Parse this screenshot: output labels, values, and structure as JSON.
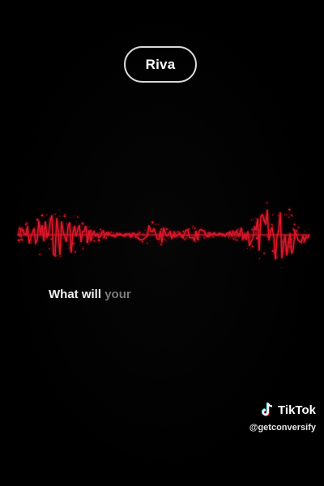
{
  "speaker": {
    "name": "Riva"
  },
  "caption": {
    "words": [
      "What",
      "will",
      "your"
    ]
  },
  "watermark": {
    "brand": "TikTok",
    "handle": "@getconversify",
    "logo_icon": "tiktok-logo-icon"
  },
  "waveform": {
    "icon": "audio-waveform-icon",
    "color": "#e0182a"
  },
  "colors": {
    "background": "#000000",
    "pill_border": "#d9d9d9",
    "caption_active": "#f2f2f2",
    "caption_pending": "#7a7a7a"
  }
}
